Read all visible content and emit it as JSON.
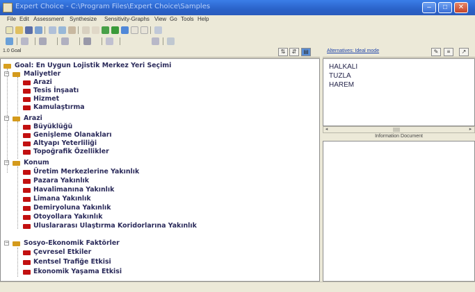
{
  "window": {
    "title": "Expert Choice - C:\\Program Files\\Expert Choice\\Samples"
  },
  "menu": {
    "items": [
      "File",
      "Edit",
      "Assessment",
      "Synthesize",
      "Sensitivity-Graphs",
      "View",
      "Go",
      "Tools",
      "Help"
    ]
  },
  "left_pane": {
    "header": "1.0 Goal"
  },
  "tree": {
    "goal": "Goal: En Uygun Lojistik Merkez Yeri Seçimi",
    "groups": [
      {
        "label": "Maliyetler",
        "children": [
          "Arazi",
          "Tesis İnşaatı",
          "Hizmet",
          "Kamulaştırma"
        ]
      },
      {
        "label": "Arazi",
        "children": [
          "Büyüklüğü",
          "Genişleme Olanakları",
          "Altyapı Yeterliliği",
          "Topoğrafik Özellikler"
        ]
      },
      {
        "label": "Konum",
        "children": [
          "Üretim Merkezlerine Yakınlık",
          "Pazara Yakınlık",
          "Havalimanına Yakınlık",
          "Limana Yakınlık",
          "Demiryoluna Yakınlık",
          "Otoyollara Yakınlık",
          "Uluslararası Ulaştırma Koridorlarına Yakınlık"
        ]
      },
      {
        "label": "Sosyo-Ekonomik Faktörler",
        "children": [
          "Çevresel Etkiler",
          "Kentsel Trafiğe Etkisi",
          "Ekonomik Yaşama Etkisi"
        ]
      }
    ]
  },
  "right_pane": {
    "header": "Alternatives: Ideal mode",
    "alternatives": [
      "HALKALI",
      "TUZLA",
      "HAREM"
    ],
    "info_header": "Information Document"
  },
  "colors": {
    "titlebar": "#2a62c9",
    "tree_text": "#2a2a5a",
    "node_icon": "#c21010",
    "goal_icon": "#d8a020"
  }
}
